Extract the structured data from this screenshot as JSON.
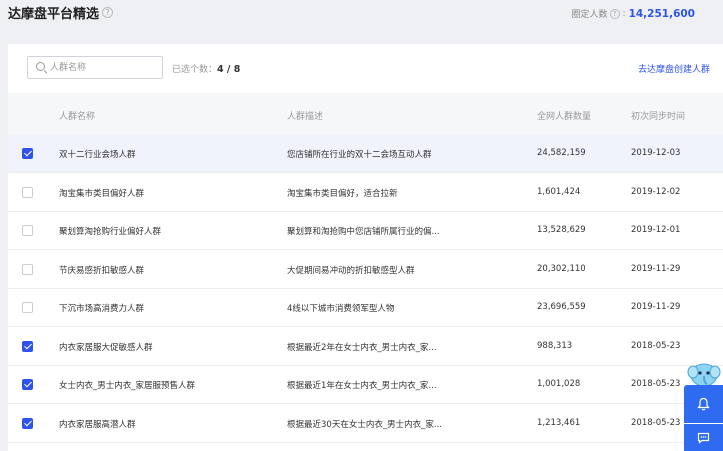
{
  "header": {
    "title": "达摩盘平台精选",
    "fixed_label": "圈定人数",
    "fixed_value": "14,251,600"
  },
  "search": {
    "placeholder": "人群名称"
  },
  "selected": {
    "label": "已选个数：",
    "value": "4 / 8"
  },
  "create_link": "去达摩盘创建人群",
  "columns": {
    "name": "人群名称",
    "desc": "人群描述",
    "count": "全网人群数量",
    "date": "初次同步时间"
  },
  "rows": [
    {
      "checked": true,
      "name": "双十二行业会场人群",
      "desc": "您店铺所在行业的双十二会场互动人群",
      "count": "24,582,159",
      "date": "2019-12-03"
    },
    {
      "checked": false,
      "name": "淘宝集市类目偏好人群",
      "desc": "淘宝集市类目偏好，适合拉新",
      "count": "1,601,424",
      "date": "2019-12-02"
    },
    {
      "checked": false,
      "name": "聚划算淘抢购行业偏好人群",
      "desc": "聚划算和淘抢购中您店铺所属行业的偏...",
      "count": "13,528,629",
      "date": "2019-12-01"
    },
    {
      "checked": false,
      "name": "节庆易感折扣敏感人群",
      "desc": "大促期间易冲动的折扣敏感型人群",
      "count": "20,302,110",
      "date": "2019-11-29"
    },
    {
      "checked": false,
      "name": "下沉市场高消费力人群",
      "desc": "4线以下城市消费领军型人物",
      "count": "23,696,559",
      "date": "2019-11-29"
    },
    {
      "checked": true,
      "name": "内衣家居服大促敏感人群",
      "desc": "根据最近2年在女士内衣_男士内衣_家...",
      "count": "988,313",
      "date": "2018-05-23"
    },
    {
      "checked": true,
      "name": "女士内衣_男士内衣_家居服预售人群",
      "desc": "根据最近1年在女士内衣_男士内衣_家...",
      "count": "1,001,028",
      "date": "2018-05-23"
    },
    {
      "checked": true,
      "name": "内衣家居服高潜人群",
      "desc": "根据最近30天在女士内衣_男士内衣_家...",
      "count": "1,213,461",
      "date": "2018-05-23"
    }
  ],
  "colors": {
    "accent": "#2f54eb",
    "float_button": "#2f6bf0"
  },
  "icons": {
    "help": "question-circle-icon",
    "search": "search-icon",
    "bell": "bell-icon",
    "chat": "chat-icon",
    "mascot": "elephant-icon"
  }
}
